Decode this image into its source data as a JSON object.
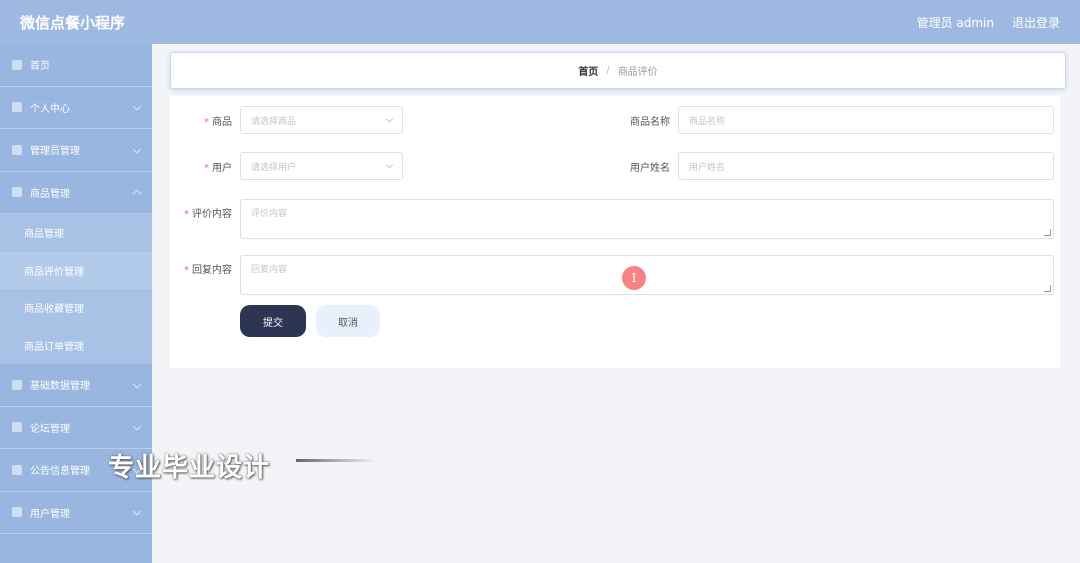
{
  "header": {
    "app_title": "微信点餐小程序",
    "admin_label": "管理员 admin",
    "logout_label": "退出登录"
  },
  "sidebar": {
    "items": [
      {
        "label": "首页",
        "icon": "home-icon"
      },
      {
        "label": "个人中心",
        "icon": "user-icon"
      },
      {
        "label": "管理员管理",
        "icon": "chart-icon"
      },
      {
        "label": "商品管理",
        "icon": "goods-icon"
      }
    ],
    "submenu": [
      {
        "label": "商品管理"
      },
      {
        "label": "商品评价管理"
      },
      {
        "label": "商品收藏管理"
      },
      {
        "label": "商品订单管理"
      }
    ],
    "items2": [
      {
        "label": "基础数据管理",
        "icon": "data-icon"
      },
      {
        "label": "论坛管理",
        "icon": "forum-icon"
      },
      {
        "label": "公告信息管理",
        "icon": "notice-icon"
      },
      {
        "label": "用户管理",
        "icon": "users-icon"
      }
    ]
  },
  "breadcrumb": {
    "home": "首页",
    "separator": "/",
    "current": "商品评价"
  },
  "form": {
    "goods_label": "商品",
    "goods_placeholder": "请选择商品",
    "goods_name_label": "商品名称",
    "goods_name_placeholder": "商品名称",
    "user_label": "用户",
    "user_placeholder": "请选择用户",
    "user_name_label": "用户姓名",
    "user_name_placeholder": "用户姓名",
    "review_label": "评价内容",
    "review_placeholder": "评价内容",
    "reply_label": "回复内容",
    "reply_placeholder": "回复内容",
    "required_mark": "*",
    "submit_label": "提交",
    "cancel_label": "取消"
  },
  "overlay": {
    "watermark": "专业毕业设计",
    "cursor_glyph": "I"
  },
  "colors": {
    "accent": "#9db9e2",
    "sidebar": "#98b6e0",
    "submit": "#2c3552",
    "required": "#f56c6c"
  }
}
